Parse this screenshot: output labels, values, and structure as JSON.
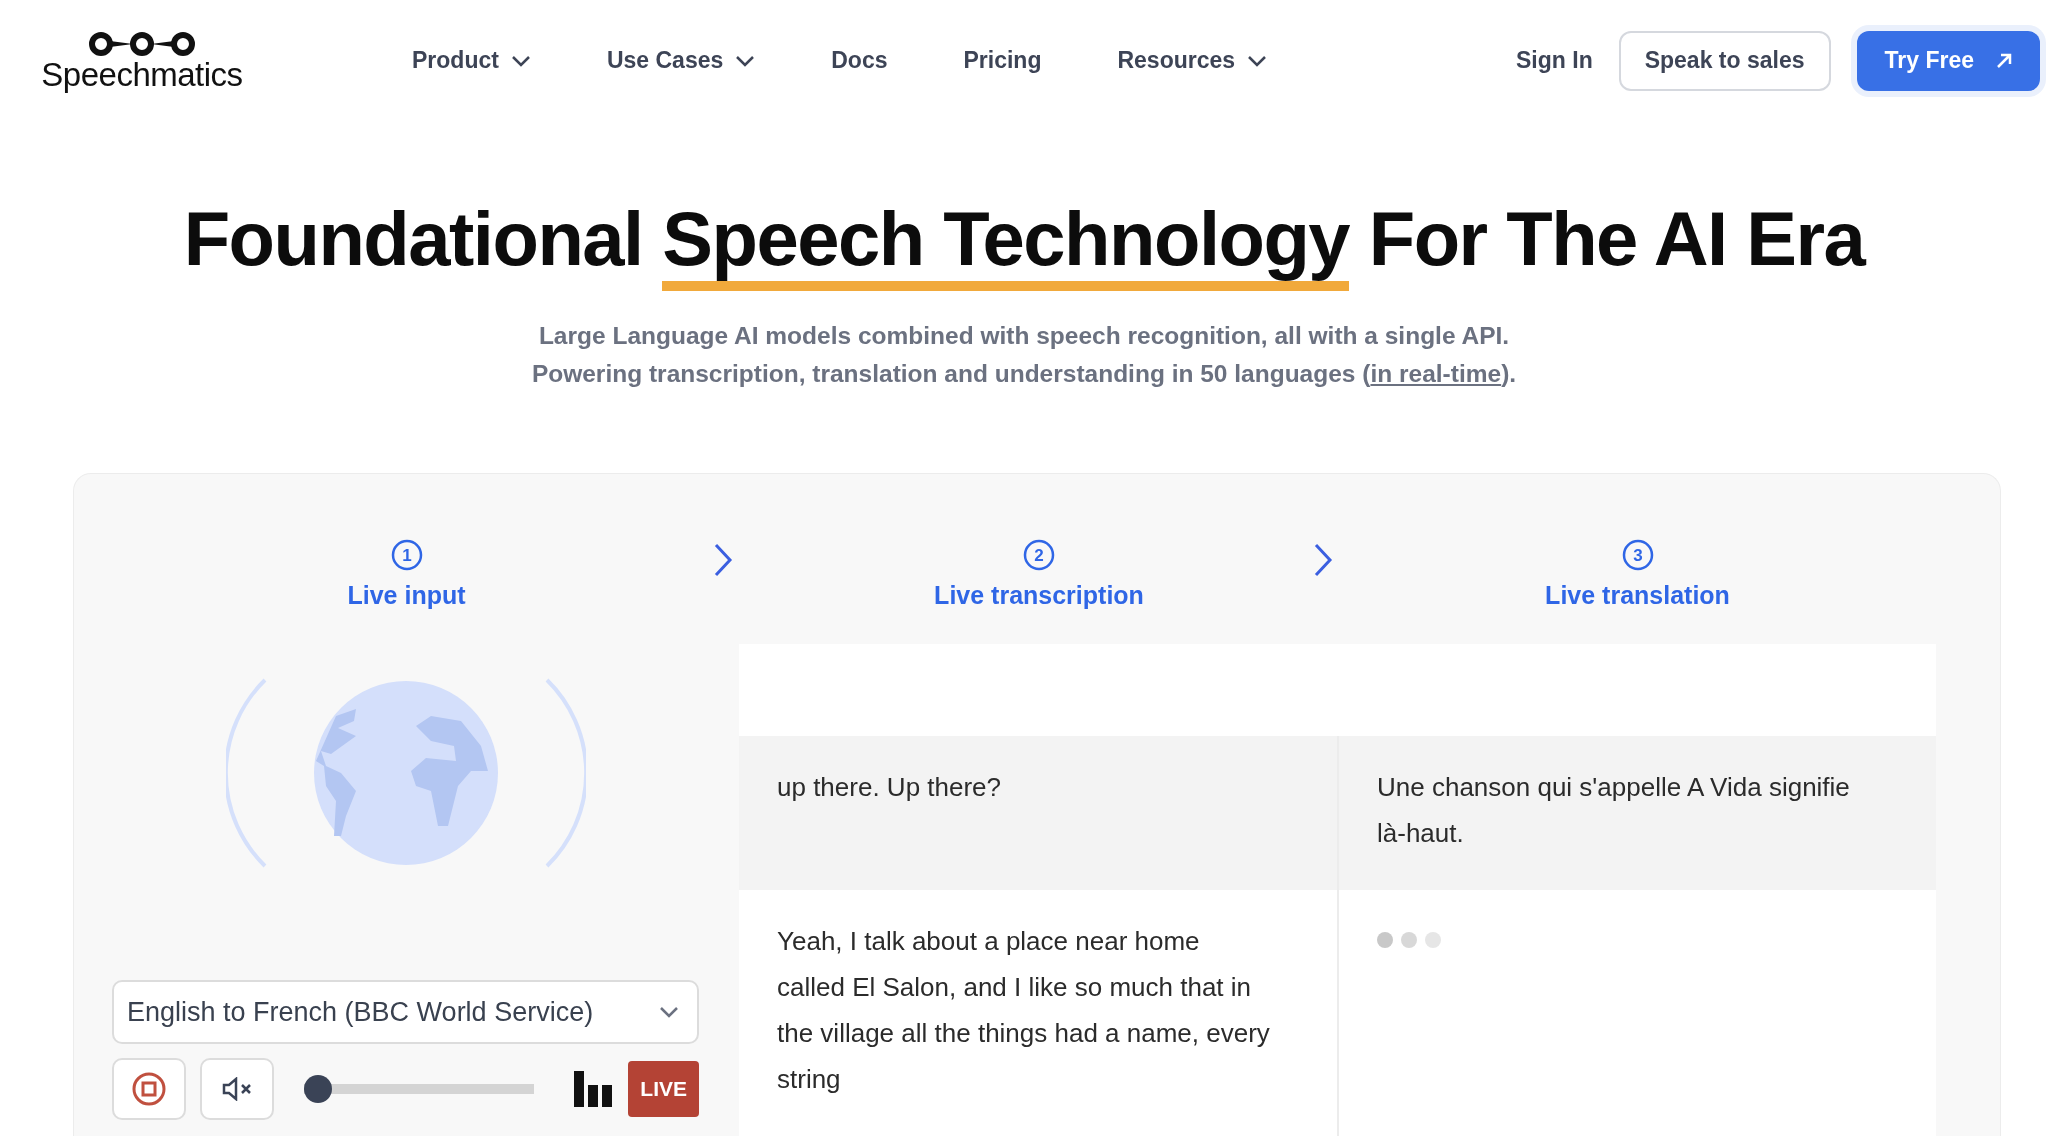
{
  "brand": {
    "name": "Speechmatics"
  },
  "nav": [
    {
      "label": "Product",
      "dropdown": true
    },
    {
      "label": "Use Cases",
      "dropdown": true
    },
    {
      "label": "Docs",
      "dropdown": false
    },
    {
      "label": "Pricing",
      "dropdown": false
    },
    {
      "label": "Resources",
      "dropdown": true
    }
  ],
  "actions": {
    "sign_in": "Sign In",
    "sales": "Speak to sales",
    "try": "Try Free"
  },
  "hero": {
    "title_before": "Foundational ",
    "title_highlight": "Speech Technology",
    "title_after": " For The AI Era",
    "subtitle_line1": "Large Language AI models combined with speech recognition, all with a single API.",
    "subtitle_line2_before": "Powering transcription, translation and understanding in 50 languages (",
    "subtitle_link": "in real-time",
    "subtitle_line2_after": ")."
  },
  "steps": [
    {
      "number": "1",
      "label": "Live input"
    },
    {
      "number": "2",
      "label": "Live transcription"
    },
    {
      "number": "3",
      "label": "Live translation"
    }
  ],
  "source": {
    "value": "English to French (BBC World Service)"
  },
  "player": {
    "volume": {
      "level": 0
    },
    "badge": "LIVE"
  },
  "rows": [
    {
      "highlighted": true,
      "transcription": "up there. Up there?",
      "translation": {
        "kind": "text",
        "text": "Une chanson qui s'appelle A Vida signifie là-haut."
      }
    },
    {
      "highlighted": false,
      "transcription": "Yeah, I talk about a place near home called El Salon, and I like so much that in the village all the things had a name, every string",
      "translation": {
        "kind": "typing"
      }
    }
  ]
}
